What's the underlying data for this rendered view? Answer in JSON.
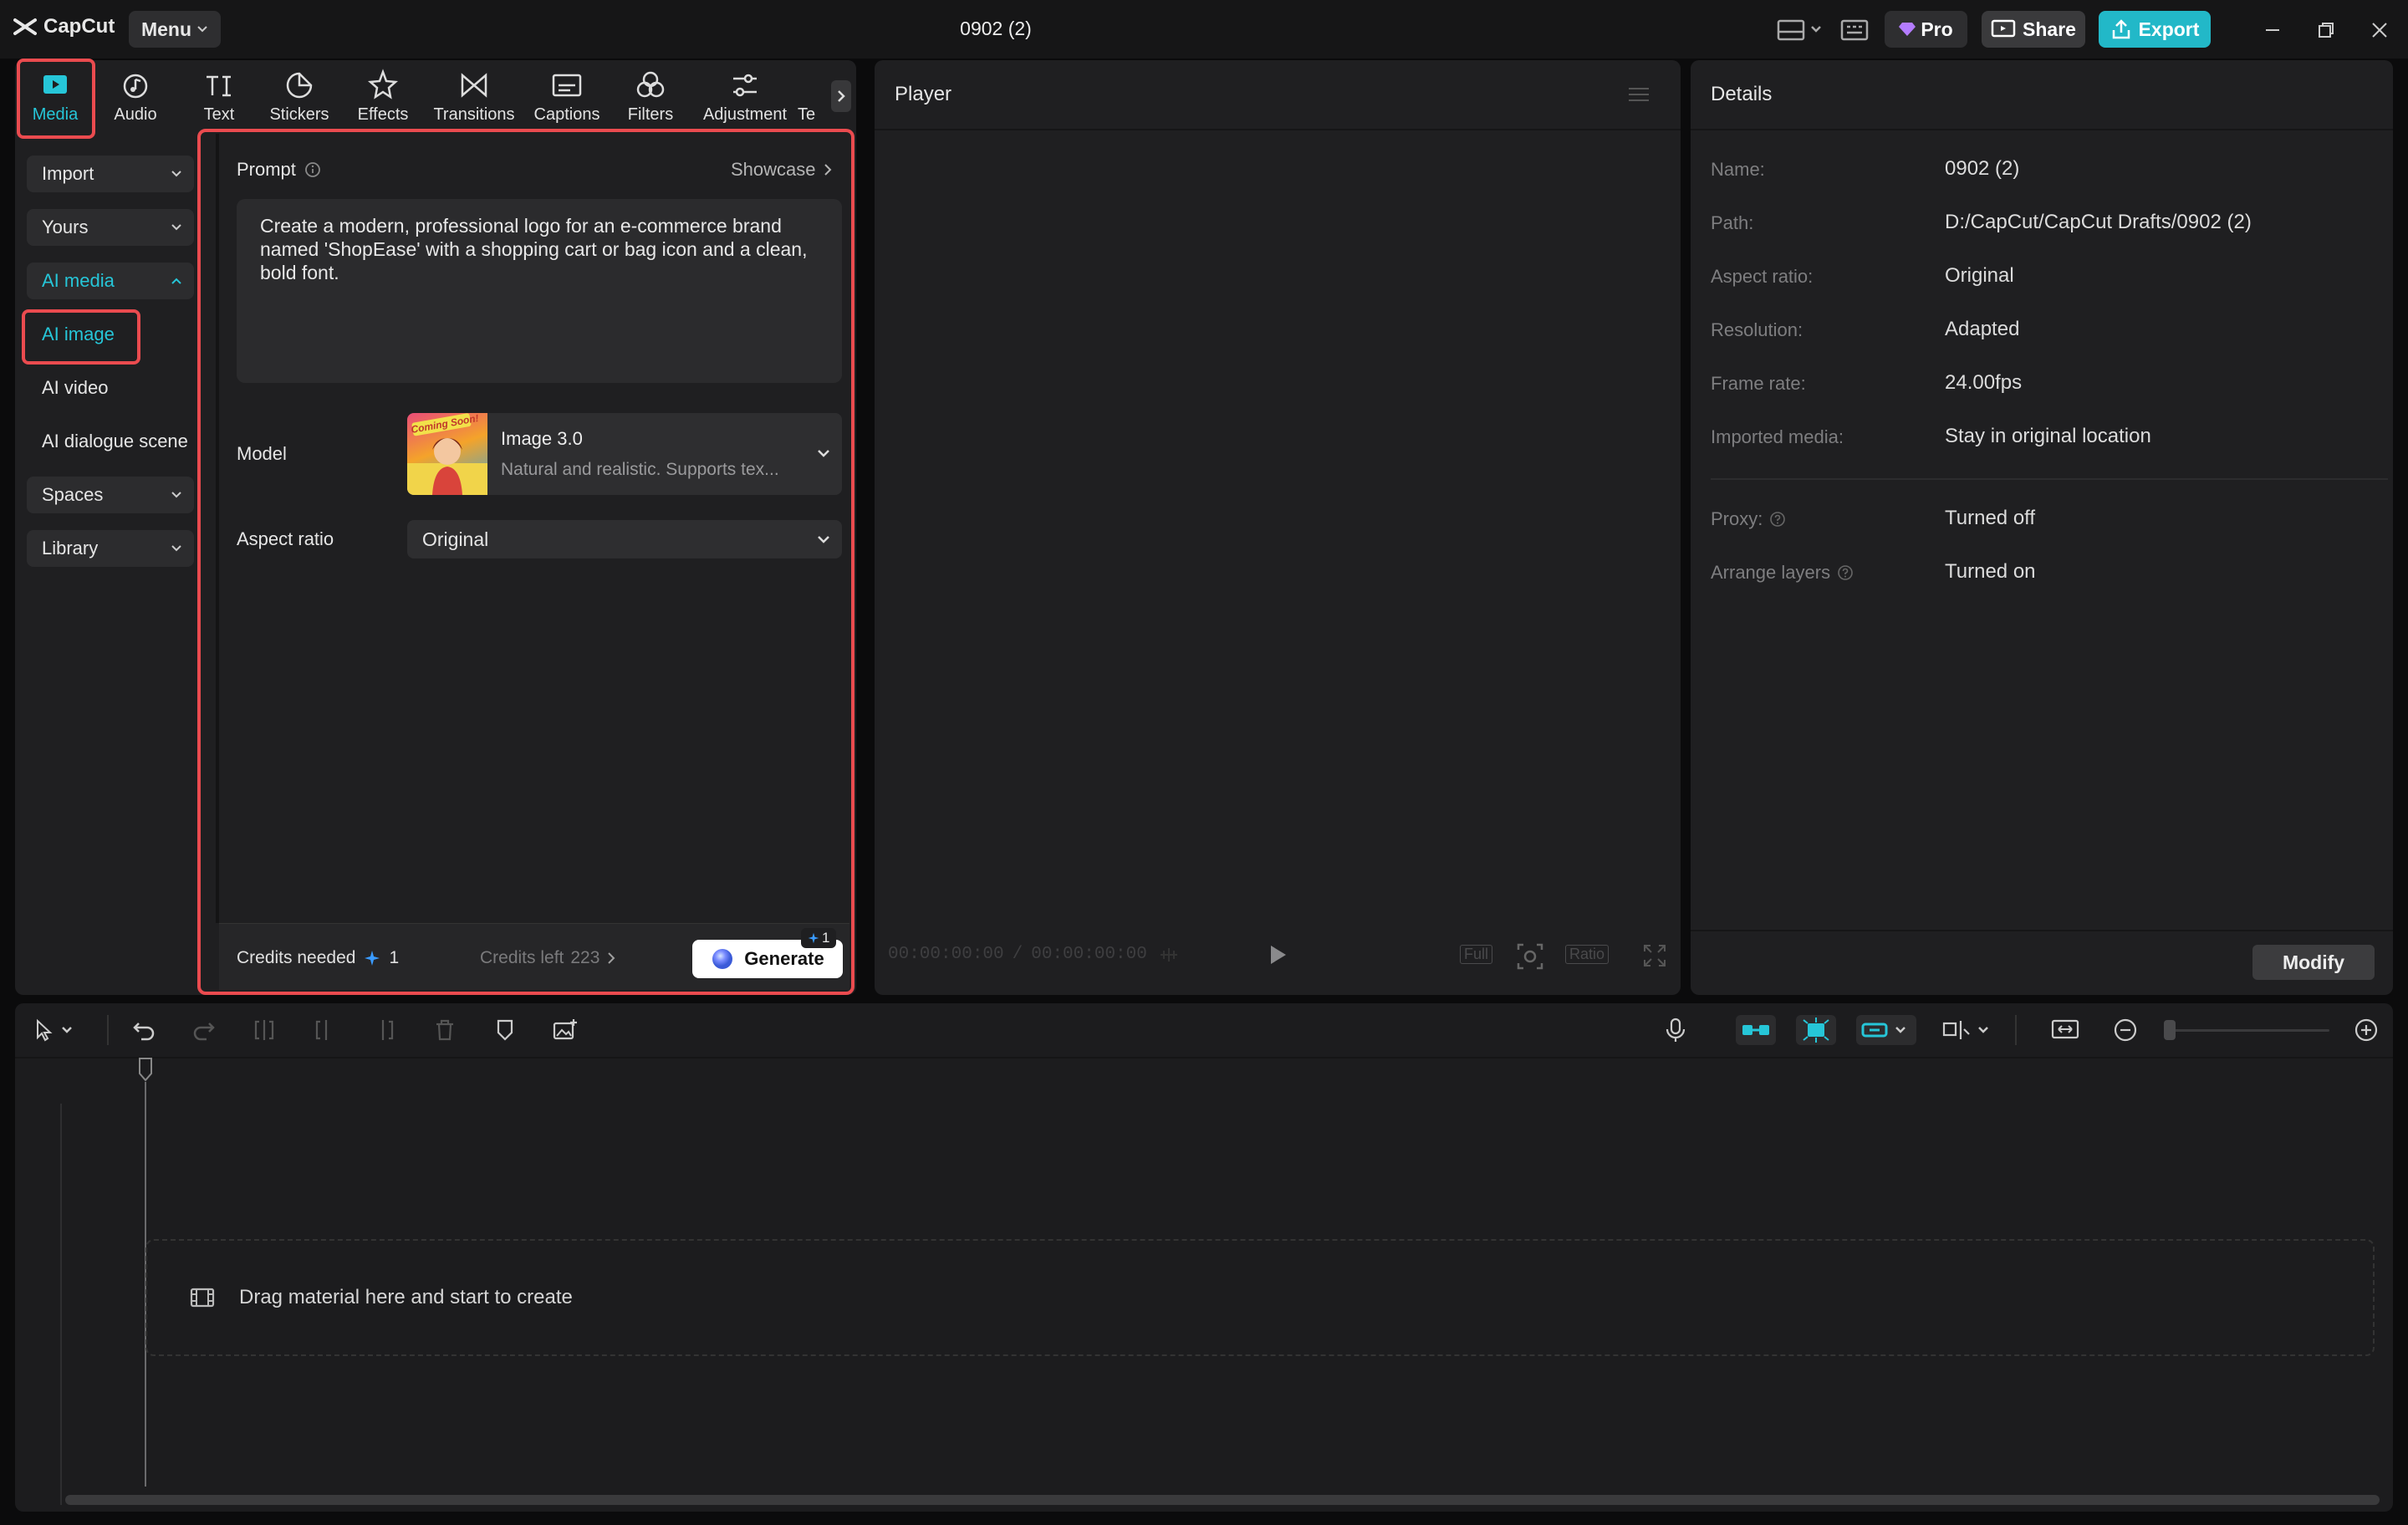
{
  "app": {
    "name": "CapCut",
    "menu_label": "Menu",
    "project_title": "0902 (2)"
  },
  "titlebar": {
    "pro_label": "Pro",
    "share_label": "Share",
    "export_label": "Export"
  },
  "tabs": [
    {
      "label": "Media",
      "icon": "media-icon",
      "active": true
    },
    {
      "label": "Audio",
      "icon": "audio-icon"
    },
    {
      "label": "Text",
      "icon": "text-icon"
    },
    {
      "label": "Stickers",
      "icon": "stickers-icon"
    },
    {
      "label": "Effects",
      "icon": "effects-icon"
    },
    {
      "label": "Transitions",
      "icon": "transitions-icon"
    },
    {
      "label": "Captions",
      "icon": "captions-icon"
    },
    {
      "label": "Filters",
      "icon": "filters-icon"
    },
    {
      "label": "Adjustment",
      "icon": "adjustment-icon"
    },
    {
      "label": "Te",
      "icon": "more-tabs"
    }
  ],
  "sidebar": {
    "import": "Import",
    "yours": "Yours",
    "ai_media": "AI media",
    "ai_image": "AI image",
    "ai_video": "AI video",
    "ai_dialogue": "AI dialogue scene",
    "spaces": "Spaces",
    "library": "Library"
  },
  "ai_image": {
    "prompt_label": "Prompt",
    "showcase_label": "Showcase",
    "prompt_text": "Create a modern, professional logo for an e-commerce brand named 'ShopEase' with a shopping cart or bag icon and a clean, bold font.",
    "model_label": "Model",
    "model_name": "Image 3.0",
    "model_desc": "Natural and realistic. Supports tex...",
    "model_thumb_text": "Coming Soon!",
    "aspect_label": "Aspect ratio",
    "aspect_value": "Original",
    "credits_needed_label": "Credits needed",
    "credits_needed_value": "1",
    "credits_left_label": "Credits left",
    "credits_left_value": "223",
    "generate_label": "Generate",
    "generate_badge": "1"
  },
  "player": {
    "title": "Player",
    "time_current": "00:00:00:00",
    "time_total": "00:00:00:00",
    "full_label": "Full",
    "ratio_label": "Ratio"
  },
  "details": {
    "title": "Details",
    "rows": [
      {
        "label": "Name:",
        "value": "0902 (2)"
      },
      {
        "label": "Path:",
        "value": "D:/CapCut/CapCut Drafts/0902 (2)"
      },
      {
        "label": "Aspect ratio:",
        "value": "Original"
      },
      {
        "label": "Resolution:",
        "value": "Adapted"
      },
      {
        "label": "Frame rate:",
        "value": "24.00fps"
      },
      {
        "label": "Imported media:",
        "value": "Stay in original location"
      },
      {
        "label": "Proxy:",
        "value": "Turned off"
      },
      {
        "label": "Arrange layers",
        "value": "Turned on"
      }
    ],
    "modify_label": "Modify"
  },
  "timeline": {
    "drop_hint": "Drag material here and start to create"
  },
  "colors": {
    "accent": "#26c6d8",
    "highlight": "#ea4b4f",
    "panel": "#1f1f21"
  }
}
